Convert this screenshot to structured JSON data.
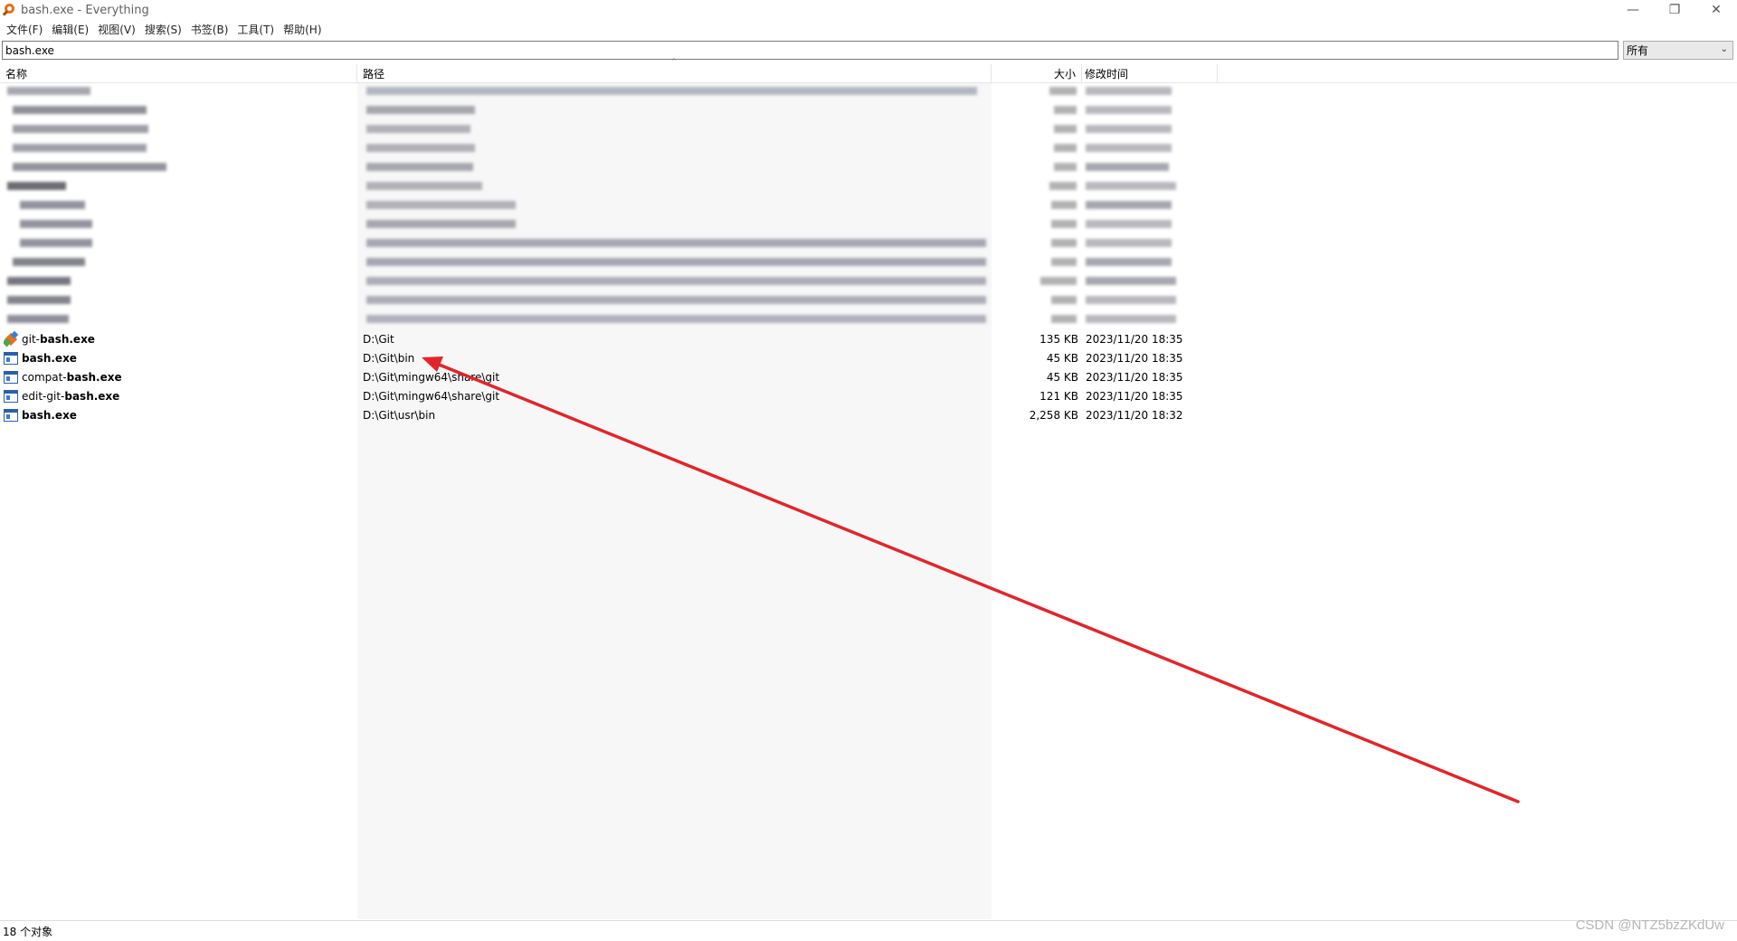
{
  "window": {
    "title": "bash.exe - Everything",
    "controls": {
      "minimize": "—",
      "restore": "❐",
      "close": "✕"
    }
  },
  "menu": [
    {
      "label": "文件(F)"
    },
    {
      "label": "编辑(E)"
    },
    {
      "label": "视图(V)"
    },
    {
      "label": "搜索(S)"
    },
    {
      "label": "书签(B)"
    },
    {
      "label": "工具(T)"
    },
    {
      "label": "帮助(H)"
    }
  ],
  "search": {
    "value": "bash.exe",
    "filter": "所有"
  },
  "columns": {
    "name": "名称",
    "path": "路径",
    "size": "大小",
    "date": "修改时间"
  },
  "results": [
    {
      "name_prefix": "git-",
      "name_match": "bash.exe",
      "path": "D:\\Git",
      "size": "135 KB",
      "date": "2023/11/20 18:35",
      "icon": "git-icon"
    },
    {
      "name_prefix": "",
      "name_match": "bash.exe",
      "path": "D:\\Git\\bin",
      "size": "45 KB",
      "date": "2023/11/20 18:35",
      "icon": "exe-icon"
    },
    {
      "name_prefix": "compat-",
      "name_match": "bash.exe",
      "path": "D:\\Git\\mingw64\\share\\git",
      "size": "45 KB",
      "date": "2023/11/20 18:35",
      "icon": "exe-icon"
    },
    {
      "name_prefix": "edit-git-",
      "name_match": "bash.exe",
      "path": "D:\\Git\\mingw64\\share\\git",
      "size": "121 KB",
      "date": "2023/11/20 18:35",
      "icon": "exe-icon"
    },
    {
      "name_prefix": "",
      "name_match": "bash.exe",
      "path": "D:\\Git\\usr\\bin",
      "size": "2,258 KB",
      "date": "2023/11/20 18:32",
      "icon": "exe-icon"
    }
  ],
  "status": {
    "count": "18 个对象"
  },
  "watermark": "CSDN @NTZ5bzZKdUw",
  "colors": {
    "annotation_arrow": "#e0262b",
    "path_column_bg": "#f7f7f7"
  }
}
